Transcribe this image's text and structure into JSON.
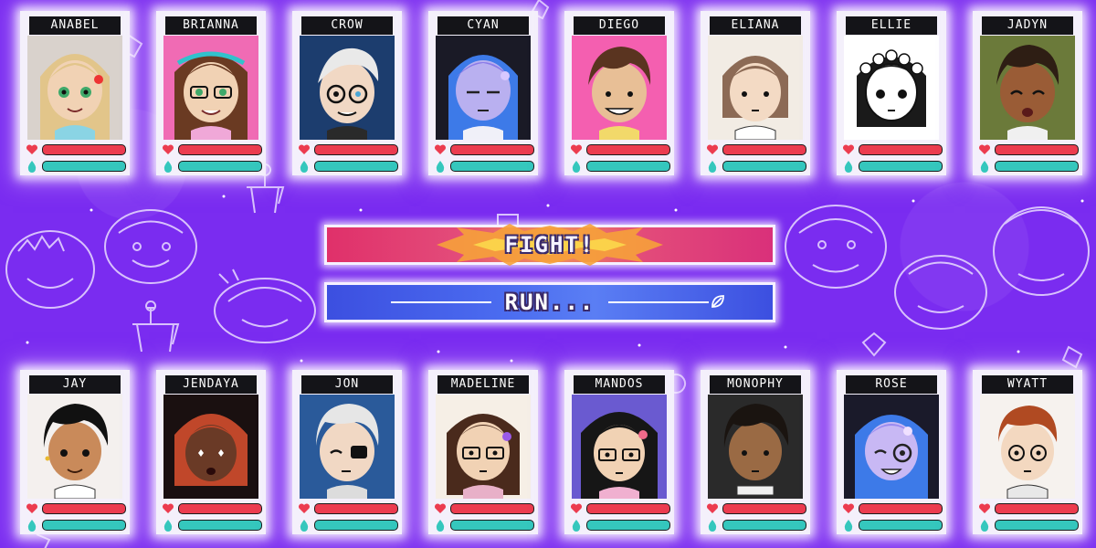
{
  "top_row": [
    {
      "name": "ANABEL",
      "skin": "#f1d2b4",
      "hair": "#e2c58a",
      "bg": "#d9d2cc",
      "eyes": "#3fa96a"
    },
    {
      "name": "BRIANNA",
      "skin": "#f1d2b4",
      "hair": "#6a3a22",
      "bg": "#f06bb4",
      "eyes": "#3fa96a"
    },
    {
      "name": "CROW",
      "skin": "#f1d8c4",
      "hair": "#e9e9e9",
      "bg": "#1c3d6e",
      "eyes": "#222222"
    },
    {
      "name": "CYAN",
      "skin": "#b9b0f0",
      "hair": "#8a7ae8",
      "bg": "#1a1a26",
      "eyes": "#222222"
    },
    {
      "name": "DIEGO",
      "skin": "#e8bf96",
      "hair": "#5a3420",
      "bg": "#f45fb0",
      "eyes": "#222222"
    },
    {
      "name": "ELIANA",
      "skin": "#f3dac4",
      "hair": "#8c6a55",
      "bg": "#f2ece4",
      "eyes": "#222222"
    },
    {
      "name": "ELLIE",
      "skin": "#ffffff",
      "hair": "#1a1a1a",
      "bg": "#ffffff",
      "eyes": "#222222"
    },
    {
      "name": "JADYN",
      "skin": "#9a5c36",
      "hair": "#2e1e14",
      "bg": "#6b7a3a",
      "eyes": "#222222"
    }
  ],
  "bottom_row": [
    {
      "name": "JAY",
      "skin": "#c98a5a",
      "hair": "#111111",
      "bg": "#f4f0ee",
      "eyes": "#222222"
    },
    {
      "name": "JENDAYA",
      "skin": "#6a3a26",
      "hair": "#c0472a",
      "bg": "#1a1010",
      "eyes": "#ffffff"
    },
    {
      "name": "JON",
      "skin": "#f1d8c4",
      "hair": "#e6e6e6",
      "bg": "#2a5a9a",
      "eyes": "#222222"
    },
    {
      "name": "MADELINE",
      "skin": "#f1d2b4",
      "hair": "#4a2a1c",
      "bg": "#f6efe6",
      "eyes": "#222222"
    },
    {
      "name": "MANDOS",
      "skin": "#f1d2b4",
      "hair": "#161616",
      "bg": "#6a5ad0",
      "eyes": "#222222"
    },
    {
      "name": "MONOPHY",
      "skin": "#9a6a44",
      "hair": "#1a1410",
      "bg": "#2a2a2a",
      "eyes": "#222222"
    },
    {
      "name": "ROSE",
      "skin": "#c8b8f4",
      "hair": "#9a8af0",
      "bg": "#1a1a2a",
      "eyes": "#222222"
    },
    {
      "name": "WYATT",
      "skin": "#f3d8c0",
      "hair": "#b04a22",
      "bg": "#f6f2ee",
      "eyes": "#222222"
    }
  ],
  "commands": {
    "fight": "FIGHT!",
    "run": "RUN..."
  },
  "colors": {
    "background": "#7a2cf0",
    "hp_bar": "#ec3c4f",
    "mp_bar": "#35c7bd",
    "card": "#f4f0fb"
  },
  "icons": {
    "hp": "heart-icon",
    "mp": "drop-icon"
  }
}
